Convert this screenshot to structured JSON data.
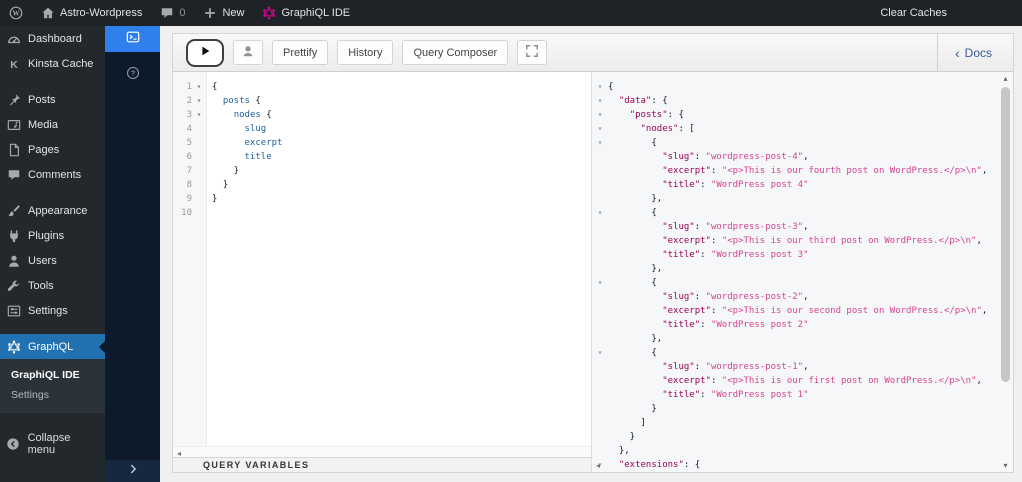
{
  "colors": {
    "admin_bar_bg": "#1d2327",
    "menu_bg": "#23282d",
    "active_blue": "#2271b1",
    "activity_blue": "#2f80ed",
    "graphql_pink": "#e10098",
    "json_key": "#990055",
    "json_string": "#d64292",
    "query_field": "#1f61a0"
  },
  "admin_bar": {
    "site_name": "Astro-Wordpress",
    "comments_count": "0",
    "new_label": "New",
    "graphiql_label": "GraphiQL IDE",
    "clear_caches_label": "Clear Caches"
  },
  "sidebar": {
    "items": [
      {
        "label": "Dashboard",
        "icon": "dashboard"
      },
      {
        "label": "Kinsta Cache",
        "icon": "kinsta"
      },
      {
        "label": "Posts",
        "icon": "posts",
        "gap": true
      },
      {
        "label": "Media",
        "icon": "media"
      },
      {
        "label": "Pages",
        "icon": "pages"
      },
      {
        "label": "Comments",
        "icon": "comments"
      },
      {
        "label": "Appearance",
        "icon": "appearance",
        "gap": true
      },
      {
        "label": "Plugins",
        "icon": "plugins"
      },
      {
        "label": "Users",
        "icon": "users"
      },
      {
        "label": "Tools",
        "icon": "tools"
      },
      {
        "label": "Settings",
        "icon": "settings"
      },
      {
        "label": "GraphQL",
        "icon": "graphql",
        "active": true,
        "gap": true
      }
    ],
    "submenu": [
      {
        "label": "GraphiQL IDE",
        "current": true
      },
      {
        "label": "Settings"
      }
    ],
    "collapse_label": "Collapse menu"
  },
  "toolbar": {
    "prettify_label": "Prettify",
    "history_label": "History",
    "query_composer_label": "Query Composer",
    "docs_label": "Docs"
  },
  "variables": {
    "title": "QUERY VARIABLES"
  },
  "editor": {
    "lines": [
      {
        "n": "1",
        "fold": true,
        "t": [
          [
            "{",
            "p"
          ]
        ]
      },
      {
        "n": "2",
        "fold": true,
        "t": [
          [
            "  ",
            "p"
          ],
          [
            "posts",
            "f"
          ],
          [
            " {",
            "p"
          ]
        ]
      },
      {
        "n": "3",
        "fold": true,
        "t": [
          [
            "    ",
            "p"
          ],
          [
            "nodes",
            "f"
          ],
          [
            " {",
            "p"
          ]
        ]
      },
      {
        "n": "4",
        "t": [
          [
            "      ",
            "p"
          ],
          [
            "slug",
            "f"
          ]
        ]
      },
      {
        "n": "5",
        "t": [
          [
            "      ",
            "p"
          ],
          [
            "excerpt",
            "f"
          ]
        ]
      },
      {
        "n": "6",
        "t": [
          [
            "      ",
            "p"
          ],
          [
            "title",
            "f"
          ]
        ]
      },
      {
        "n": "7",
        "t": [
          [
            "    }",
            "p"
          ]
        ]
      },
      {
        "n": "8",
        "t": [
          [
            "  }",
            "p"
          ]
        ]
      },
      {
        "n": "9",
        "t": [
          [
            "}",
            "p"
          ]
        ]
      },
      {
        "n": "10",
        "t": []
      }
    ]
  },
  "result": {
    "lines": [
      {
        "fold": true,
        "t": [
          [
            "{",
            "p"
          ]
        ]
      },
      {
        "fold": true,
        "t": [
          [
            "  ",
            "p"
          ],
          [
            "\"data\"",
            "k"
          ],
          [
            ": {",
            "p"
          ]
        ]
      },
      {
        "fold": true,
        "t": [
          [
            "    ",
            "p"
          ],
          [
            "\"posts\"",
            "k"
          ],
          [
            ": {",
            "p"
          ]
        ]
      },
      {
        "fold": true,
        "t": [
          [
            "      ",
            "p"
          ],
          [
            "\"nodes\"",
            "k"
          ],
          [
            ": [",
            "p"
          ]
        ]
      },
      {
        "fold": true,
        "t": [
          [
            "        {",
            "p"
          ]
        ]
      },
      {
        "t": [
          [
            "          ",
            "p"
          ],
          [
            "\"slug\"",
            "k"
          ],
          [
            ": ",
            "p"
          ],
          [
            "\"wordpress-post-4\"",
            "s"
          ],
          [
            ",",
            "p"
          ]
        ]
      },
      {
        "t": [
          [
            "          ",
            "p"
          ],
          [
            "\"excerpt\"",
            "k"
          ],
          [
            ": ",
            "p"
          ],
          [
            "\"<p>This is our fourth post on WordPress.</p>\\n\"",
            "s"
          ],
          [
            ",",
            "p"
          ]
        ]
      },
      {
        "t": [
          [
            "          ",
            "p"
          ],
          [
            "\"title\"",
            "k"
          ],
          [
            ": ",
            "p"
          ],
          [
            "\"WordPress post 4\"",
            "s"
          ]
        ]
      },
      {
        "t": [
          [
            "        },",
            "p"
          ]
        ]
      },
      {
        "fold": true,
        "t": [
          [
            "        {",
            "p"
          ]
        ]
      },
      {
        "t": [
          [
            "          ",
            "p"
          ],
          [
            "\"slug\"",
            "k"
          ],
          [
            ": ",
            "p"
          ],
          [
            "\"wordpress-post-3\"",
            "s"
          ],
          [
            ",",
            "p"
          ]
        ]
      },
      {
        "t": [
          [
            "          ",
            "p"
          ],
          [
            "\"excerpt\"",
            "k"
          ],
          [
            ": ",
            "p"
          ],
          [
            "\"<p>This is our third post on WordPress.</p>\\n\"",
            "s"
          ],
          [
            ",",
            "p"
          ]
        ]
      },
      {
        "t": [
          [
            "          ",
            "p"
          ],
          [
            "\"title\"",
            "k"
          ],
          [
            ": ",
            "p"
          ],
          [
            "\"WordPress post 3\"",
            "s"
          ]
        ]
      },
      {
        "t": [
          [
            "        },",
            "p"
          ]
        ]
      },
      {
        "fold": true,
        "t": [
          [
            "        {",
            "p"
          ]
        ]
      },
      {
        "t": [
          [
            "          ",
            "p"
          ],
          [
            "\"slug\"",
            "k"
          ],
          [
            ": ",
            "p"
          ],
          [
            "\"wordpress-post-2\"",
            "s"
          ],
          [
            ",",
            "p"
          ]
        ]
      },
      {
        "t": [
          [
            "          ",
            "p"
          ],
          [
            "\"excerpt\"",
            "k"
          ],
          [
            ": ",
            "p"
          ],
          [
            "\"<p>This is our second post on WordPress.</p>\\n\"",
            "s"
          ],
          [
            ",",
            "p"
          ]
        ]
      },
      {
        "t": [
          [
            "          ",
            "p"
          ],
          [
            "\"title\"",
            "k"
          ],
          [
            ": ",
            "p"
          ],
          [
            "\"WordPress post 2\"",
            "s"
          ]
        ]
      },
      {
        "t": [
          [
            "        },",
            "p"
          ]
        ]
      },
      {
        "fold": true,
        "t": [
          [
            "        {",
            "p"
          ]
        ]
      },
      {
        "t": [
          [
            "          ",
            "p"
          ],
          [
            "\"slug\"",
            "k"
          ],
          [
            ": ",
            "p"
          ],
          [
            "\"wordpress-post-1\"",
            "s"
          ],
          [
            ",",
            "p"
          ]
        ]
      },
      {
        "t": [
          [
            "          ",
            "p"
          ],
          [
            "\"excerpt\"",
            "k"
          ],
          [
            ": ",
            "p"
          ],
          [
            "\"<p>This is our first post on WordPress.</p>\\n\"",
            "s"
          ],
          [
            ",",
            "p"
          ]
        ]
      },
      {
        "t": [
          [
            "          ",
            "p"
          ],
          [
            "\"title\"",
            "k"
          ],
          [
            ": ",
            "p"
          ],
          [
            "\"WordPress post 1\"",
            "s"
          ]
        ]
      },
      {
        "t": [
          [
            "        }",
            "p"
          ]
        ]
      },
      {
        "t": [
          [
            "      ]",
            "p"
          ]
        ]
      },
      {
        "t": [
          [
            "    }",
            "p"
          ]
        ]
      },
      {
        "t": [
          [
            "  },",
            "p"
          ]
        ]
      },
      {
        "fold": true,
        "t": [
          [
            "  ",
            "p"
          ],
          [
            "\"extensions\"",
            "k"
          ],
          [
            ": {",
            "p"
          ]
        ]
      }
    ]
  }
}
